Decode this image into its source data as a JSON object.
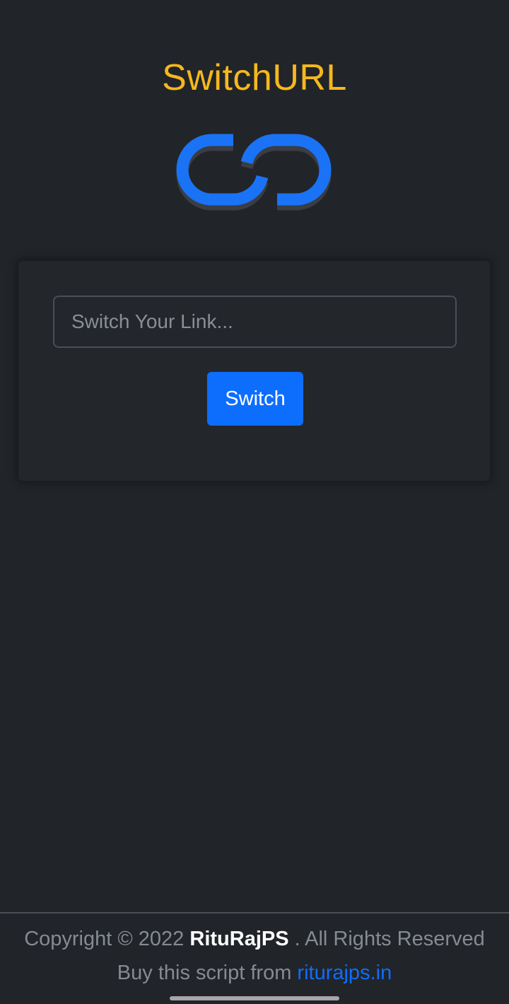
{
  "app": {
    "title": "SwitchURL",
    "logo_icon": "link-chain-icon"
  },
  "form": {
    "input_value": "",
    "input_placeholder": "Switch Your Link...",
    "button_label": "Switch"
  },
  "footer": {
    "copyright_prefix": "Copyright © 2022",
    "brand": "RituRajPS",
    "copyright_suffix": ". All Rights Reserved",
    "buy_text": "Buy this script from",
    "site_link": "riturajps.in"
  },
  "colors": {
    "background": "#212429",
    "title": "#f5b81d",
    "accent": "#0d6efd",
    "card": "#23262b"
  }
}
